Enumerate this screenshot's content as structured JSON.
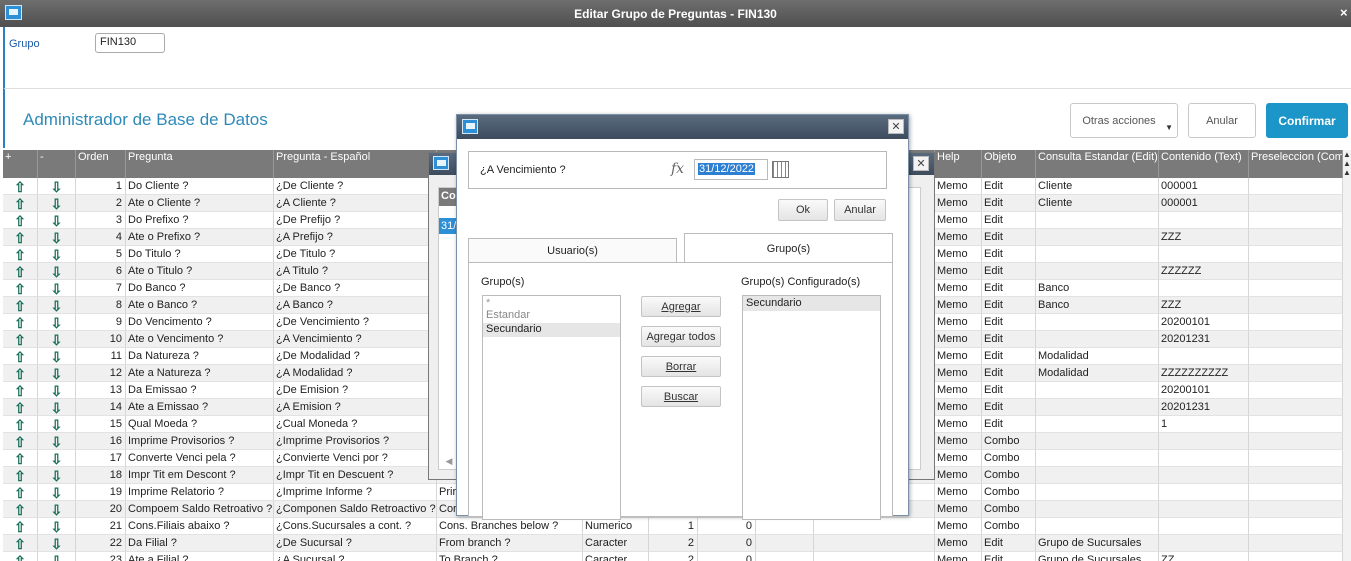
{
  "window": {
    "title": "Editar Grupo de Preguntas - FIN130",
    "close": "×"
  },
  "grupo": {
    "label": "Grupo",
    "value": "FIN130"
  },
  "header": {
    "title": "Administrador de Base de Datos",
    "otras_acciones": "Otras acciones",
    "anular": "Anular",
    "confirmar": "Confirmar"
  },
  "columns": {
    "plus": "+",
    "minus": "-",
    "orden": "Orden",
    "pregunta": "Pregunta",
    "pregunta_es": "Pregunta - Español",
    "help": "Help",
    "objeto": "Objeto",
    "consulta": "Consulta Estandar (Edit)",
    "contenido": "Contenido (Text)",
    "preseleccion": "Preseleccion (Com"
  },
  "rows": [
    {
      "orden": "1",
      "pregunta": "Do Cliente ?",
      "es": "¿De Cliente ?",
      "en": "",
      "tipo": "",
      "t1": "",
      "t2": "",
      "help": "Memo",
      "objeto": "Edit",
      "consulta": "Cliente",
      "contenido": "000001"
    },
    {
      "orden": "2",
      "pregunta": "Ate o Cliente ?",
      "es": "¿A Cliente ?",
      "en": "",
      "tipo": "",
      "t1": "",
      "t2": "",
      "help": "Memo",
      "objeto": "Edit",
      "consulta": "Cliente",
      "contenido": "000001"
    },
    {
      "orden": "3",
      "pregunta": "Do Prefixo ?",
      "es": "¿De Prefijo ?",
      "en": "",
      "tipo": "",
      "t1": "",
      "t2": "",
      "help": "Memo",
      "objeto": "Edit",
      "consulta": "",
      "contenido": ""
    },
    {
      "orden": "4",
      "pregunta": "Ate o Prefixo ?",
      "es": "¿A Prefijo ?",
      "en": "",
      "tipo": "",
      "t1": "",
      "t2": "",
      "help": "Memo",
      "objeto": "Edit",
      "consulta": "",
      "contenido": "ZZZ"
    },
    {
      "orden": "5",
      "pregunta": "Do Titulo ?",
      "es": "¿De Titulo ?",
      "en": "",
      "tipo": "",
      "t1": "",
      "t2": "",
      "help": "Memo",
      "objeto": "Edit",
      "consulta": "",
      "contenido": ""
    },
    {
      "orden": "6",
      "pregunta": "Ate o Titulo ?",
      "es": "¿A Titulo ?",
      "en": "",
      "tipo": "",
      "t1": "",
      "t2": "",
      "help": "Memo",
      "objeto": "Edit",
      "consulta": "",
      "contenido": "ZZZZZZ"
    },
    {
      "orden": "7",
      "pregunta": "Do Banco ?",
      "es": "¿De Banco ?",
      "en": "",
      "tipo": "",
      "t1": "",
      "t2": "",
      "help": "Memo",
      "objeto": "Edit",
      "consulta": "Banco",
      "contenido": ""
    },
    {
      "orden": "8",
      "pregunta": "Ate o Banco ?",
      "es": "¿A Banco ?",
      "en": "",
      "tipo": "",
      "t1": "",
      "t2": "",
      "help": "Memo",
      "objeto": "Edit",
      "consulta": "Banco",
      "contenido": "ZZZ"
    },
    {
      "orden": "9",
      "pregunta": "Do Vencimento ?",
      "es": "¿De Vencimiento ?",
      "en": "",
      "tipo": "",
      "t1": "",
      "t2": "",
      "help": "Memo",
      "objeto": "Edit",
      "consulta": "",
      "contenido": "20200101"
    },
    {
      "orden": "10",
      "pregunta": "Ate o Vencimento ?",
      "es": "¿A Vencimiento ?",
      "en": "",
      "tipo": "",
      "t1": "",
      "t2": "",
      "help": "Memo",
      "objeto": "Edit",
      "consulta": "",
      "contenido": "20201231"
    },
    {
      "orden": "11",
      "pregunta": "Da Natureza ?",
      "es": "¿De Modalidad ?",
      "en": "",
      "tipo": "",
      "t1": "",
      "t2": "",
      "help": "Memo",
      "objeto": "Edit",
      "consulta": "Modalidad",
      "contenido": ""
    },
    {
      "orden": "12",
      "pregunta": "Ate a Natureza ?",
      "es": "¿A Modalidad ?",
      "en": "",
      "tipo": "",
      "t1": "",
      "t2": "",
      "help": "Memo",
      "objeto": "Edit",
      "consulta": "Modalidad",
      "contenido": "ZZZZZZZZZZ"
    },
    {
      "orden": "13",
      "pregunta": "Da Emissao ?",
      "es": "¿De Emision ?",
      "en": "",
      "tipo": "",
      "t1": "",
      "t2": "",
      "help": "Memo",
      "objeto": "Edit",
      "consulta": "",
      "contenido": "20200101"
    },
    {
      "orden": "14",
      "pregunta": "Ate a Emissao ?",
      "es": "¿A Emision ?",
      "en": "",
      "tipo": "",
      "t1": "",
      "t2": "",
      "help": "Memo",
      "objeto": "Edit",
      "consulta": "",
      "contenido": "20201231"
    },
    {
      "orden": "15",
      "pregunta": "Qual Moeda ?",
      "es": "¿Cual Moneda ?",
      "en": "",
      "tipo": "",
      "t1": "",
      "t2": "",
      "help": "Memo",
      "objeto": "Edit",
      "consulta": "",
      "contenido": "1"
    },
    {
      "orden": "16",
      "pregunta": "Imprime Provisorios ?",
      "es": "¿Imprime Provisorios ?",
      "en": "",
      "tipo": "",
      "t1": "",
      "t2": "",
      "help": "Memo",
      "objeto": "Combo",
      "consulta": "",
      "contenido": ""
    },
    {
      "orden": "17",
      "pregunta": "Converte Venci pela ?",
      "es": "¿Convierte Venci por ?",
      "en": "",
      "tipo": "",
      "t1": "",
      "t2": "",
      "help": "Memo",
      "objeto": "Combo",
      "consulta": "",
      "contenido": ""
    },
    {
      "orden": "18",
      "pregunta": "Impr Tit em Descont ?",
      "es": "¿Impr Tit en Descuent ?",
      "en": "",
      "tipo": "",
      "t1": "",
      "t2": "",
      "help": "Memo",
      "objeto": "Combo",
      "consulta": "",
      "contenido": ""
    },
    {
      "orden": "19",
      "pregunta": "Imprime Relatorio ?",
      "es": "¿Imprime Informe ?",
      "en": "Prir",
      "tipo": "",
      "t1": "",
      "t2": "",
      "help": "Memo",
      "objeto": "Combo",
      "consulta": "",
      "contenido": ""
    },
    {
      "orden": "20",
      "pregunta": "Compoem Saldo Retroativo ?",
      "es": "¿Componen Saldo Retroactivo ?",
      "en": "Cor",
      "tipo": "",
      "t1": "",
      "t2": "",
      "help": "Memo",
      "objeto": "Combo",
      "consulta": "",
      "contenido": ""
    },
    {
      "orden": "21",
      "pregunta": "Cons.Filiais abaixo ?",
      "es": "¿Cons.Sucursales a cont. ?",
      "en": "Cons. Branches below ?",
      "tipo": "Numerico",
      "t1": "1",
      "t2": "0",
      "help": "Memo",
      "objeto": "Combo",
      "consulta": "",
      "contenido": ""
    },
    {
      "orden": "22",
      "pregunta": "Da Filial ?",
      "es": "¿De Sucursal ?",
      "en": "From branch ?",
      "tipo": "Caracter",
      "t1": "2",
      "t2": "0",
      "help": "Memo",
      "objeto": "Edit",
      "consulta": "Grupo de Sucursales",
      "contenido": ""
    },
    {
      "orden": "23",
      "pregunta": "Ate a Filial ?",
      "es": "¿A Sucursal ?",
      "en": "To Branch ?",
      "tipo": "Caracter",
      "t1": "2",
      "t2": "0",
      "help": "Memo",
      "objeto": "Edit",
      "consulta": "Grupo de Sucursales",
      "contenido": "ZZ"
    }
  ],
  "back_dialog": {
    "col_label": "Co",
    "value_label": "31/"
  },
  "dialog": {
    "question": "¿A Vencimiento ?",
    "fx": "fx",
    "date_value": "31/12/2022",
    "ok": "Ok",
    "anular": "Anular",
    "tab_usuarios": "Usuario(s)",
    "tab_grupos": "Grupo(s)",
    "grupos_label": "Grupo(s)",
    "configurados_label": "Grupo(s) Configurado(s)",
    "grupos": [
      "*",
      "Estandar",
      "Secundario"
    ],
    "configurados": [
      "Secundario"
    ],
    "agregar": "Agregar",
    "agregar_todos": "Agregar todos",
    "borrar": "Borrar",
    "buscar": "Buscar"
  },
  "colors": {
    "accent": "#1c95c8",
    "title_blue": "#2d8ab8",
    "arrow": "#19705a",
    "header_gray": "#7a7a7a"
  }
}
